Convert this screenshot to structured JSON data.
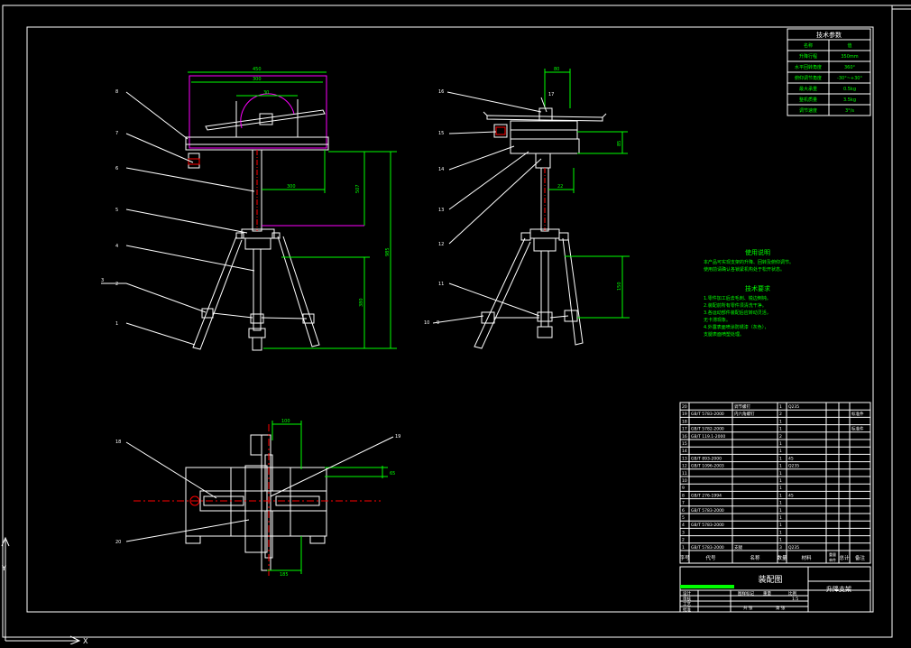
{
  "tech_params": {
    "title": "技术参数",
    "rows": [
      {
        "key": "名称",
        "value": "值"
      },
      {
        "key": "升降行程",
        "value": "350mm"
      },
      {
        "key": "水平回转角度",
        "value": "360°"
      },
      {
        "key": "俯仰调节角度",
        "value": "-30°~+30°"
      },
      {
        "key": "最大承重",
        "value": "0.5kg"
      },
      {
        "key": "整机质量",
        "value": "3.5kg"
      },
      {
        "key": "调节速度",
        "value": "3°/s"
      }
    ]
  },
  "usage_notes": {
    "title": "使用说明",
    "lines": [
      "本产品可实现支架的升降、回转及俯仰调节。",
      "使用前请确认各锁紧机构处于松开状态。"
    ]
  },
  "tech_requirements": {
    "title": "技术要求",
    "lines": [
      "1.零件加工后去毛刺、锐边倒钝。",
      "2.装配前所有零件须清洗干净。",
      "3.各运动部件装配后应转动灵活，",
      "无卡滞现象。",
      "4.外露表面喷涂防锈漆（灰色），",
      "支腿表面喷塑处理。"
    ]
  },
  "balloons": {
    "front": [
      "8",
      "7",
      "6",
      "5",
      "4",
      "3",
      "2",
      "1"
    ],
    "side": [
      "16",
      "17",
      "15",
      "14",
      "13",
      "12",
      "11",
      "10",
      "9"
    ],
    "top": [
      "18",
      "19",
      "20"
    ]
  },
  "dims": {
    "front": [
      "450",
      "300",
      "30",
      "300",
      "507",
      "985",
      "380"
    ],
    "side": [
      "80",
      "85",
      "22",
      "150"
    ],
    "top": [
      "100",
      "65",
      "185"
    ]
  },
  "bom": {
    "headers": [
      "序号",
      "代号",
      "名称",
      "数量",
      "材料",
      "单件",
      "总计",
      "备注"
    ],
    "header_weight": "重量",
    "rows": [
      [
        "20",
        "",
        "调节螺钉",
        "1",
        "Q235",
        "",
        "",
        ""
      ],
      [
        "19",
        "GB/T 5783-2000",
        "内六角螺钉",
        "2",
        "",
        "",
        "",
        "标准件"
      ],
      [
        "18",
        "",
        "",
        "1",
        "",
        "",
        "",
        ""
      ],
      [
        "17",
        "GB/T 5782-2000",
        "",
        "1",
        "",
        "",
        "",
        "标准件"
      ],
      [
        "16",
        "GB/T 119.1-2000",
        "",
        "2",
        "",
        "",
        "",
        ""
      ],
      [
        "15",
        "",
        "",
        "1",
        "",
        "",
        "",
        ""
      ],
      [
        "14",
        "",
        "",
        "1",
        "",
        "",
        "",
        ""
      ],
      [
        "13",
        "GB/T 893-2000",
        "",
        "1",
        "45",
        "",
        "",
        ""
      ],
      [
        "12",
        "GB/T 1096-2003",
        "",
        "1",
        "Q235",
        "",
        "",
        ""
      ],
      [
        "11",
        "",
        "",
        "1",
        "",
        "",
        "",
        ""
      ],
      [
        "10",
        "",
        "",
        "1",
        "",
        "",
        "",
        ""
      ],
      [
        "9",
        "",
        "",
        "1",
        "",
        "",
        "",
        ""
      ],
      [
        "8",
        "GB/T 276-1994",
        "",
        "1",
        "45",
        "",
        "",
        ""
      ],
      [
        "7",
        "",
        "",
        "1",
        "",
        "",
        "",
        ""
      ],
      [
        "6",
        "GB/T 5783-2000",
        "",
        "1",
        "",
        "",
        "",
        ""
      ],
      [
        "5",
        "",
        "",
        "1",
        "",
        "",
        "",
        ""
      ],
      [
        "4",
        "GB/T 5783-2000",
        "",
        "1",
        "",
        "",
        "",
        ""
      ],
      [
        "3",
        "",
        "",
        "1",
        "",
        "",
        "",
        ""
      ],
      [
        "2",
        "",
        "",
        "1",
        "",
        "",
        "",
        ""
      ],
      [
        "1",
        "GB/T 5783-2000",
        "支腿",
        "3",
        "Q235",
        "",
        "",
        ""
      ]
    ]
  },
  "title_block": {
    "drawing_type": "装配图",
    "name": "升降支架",
    "labels": [
      "设计",
      "审核",
      "工艺",
      "批准"
    ],
    "scale_labels": [
      "图样标记",
      "重量",
      "比例"
    ],
    "sheet_labels": [
      "共 张",
      "第 张"
    ],
    "scale_value": "1:5"
  },
  "colors": {
    "background": "#000000",
    "frame": "#ffffff",
    "geometry": "#ffffff",
    "dimension": "#00ff00",
    "leader": "#ffffff",
    "centerline": "#ff0000",
    "hidden": "#ff00ff",
    "note_text": "#00ff00"
  }
}
